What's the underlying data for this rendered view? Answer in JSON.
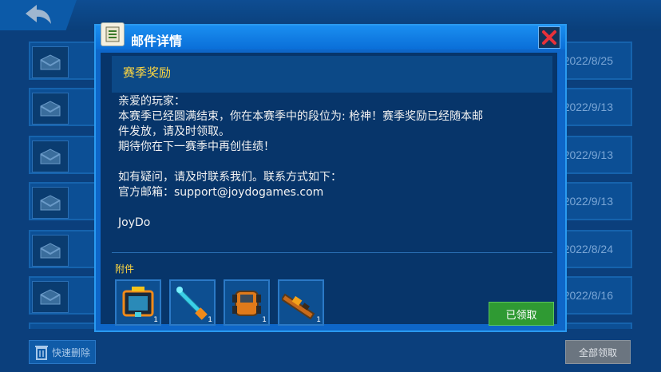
{
  "background": {
    "dates": [
      "2022/8/25",
      "2022/9/13",
      "2022/9/13",
      "2022/9/13",
      "2022/8/24",
      "2022/8/16"
    ],
    "quick_delete_label": "快速删除",
    "claim_all_label": "全部领取"
  },
  "dialog": {
    "title": "邮件详情",
    "subject": "赛季奖励",
    "body_lines": [
      "亲爱的玩家：",
      "本赛季已经圆满结束，你在本赛季中的段位为: 枪神！赛季奖励已经随本邮",
      "件发放，请及时领取。",
      "期待你在下一赛季中再创佳绩！",
      "",
      "如有疑问，请及时联系我们。联系方式如下：",
      "官方邮箱：support@joydogames.com",
      "",
      "JoyDo"
    ],
    "attachments_label": "附件",
    "attachments": [
      {
        "icon": "armor-chest-icon",
        "qty": "1"
      },
      {
        "icon": "chainsaw-sword-icon",
        "qty": "1"
      },
      {
        "icon": "combat-vehicle-icon",
        "qty": "1"
      },
      {
        "icon": "rocket-launcher-icon",
        "qty": "1"
      }
    ],
    "claimed_label": "已领取"
  },
  "colors": {
    "accent_yellow": "#ffd740",
    "claimed_green": "#2f9a33",
    "close_red": "#e8313a"
  }
}
